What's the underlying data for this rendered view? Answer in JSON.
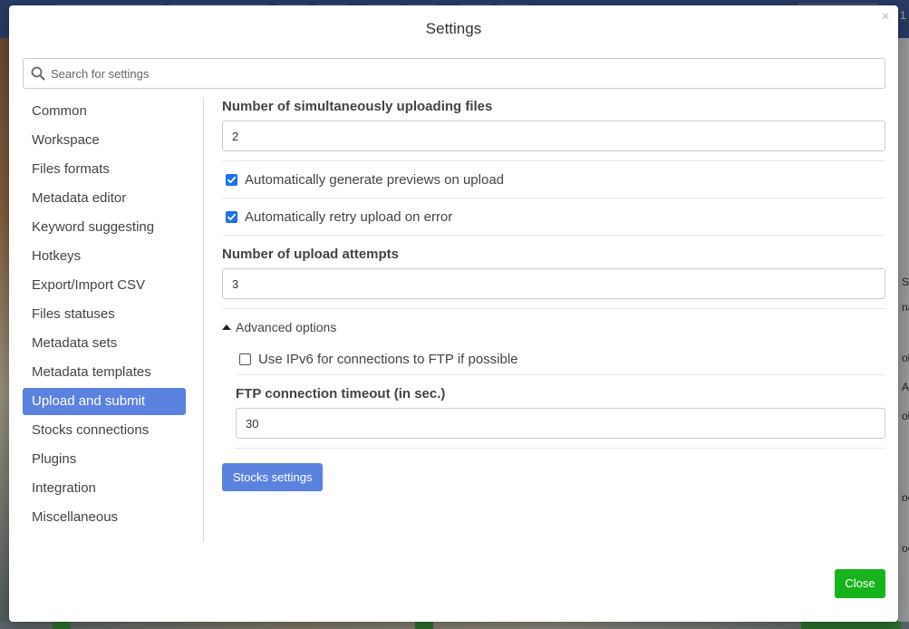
{
  "dialog": {
    "title": "Settings",
    "close_glyph": "×",
    "close_label": "Close"
  },
  "search": {
    "placeholder": "Search for settings",
    "value": ""
  },
  "sidebar": {
    "items": [
      {
        "label": "Common"
      },
      {
        "label": "Workspace"
      },
      {
        "label": "Files formats"
      },
      {
        "label": "Metadata editor"
      },
      {
        "label": "Keyword suggesting"
      },
      {
        "label": "Hotkeys"
      },
      {
        "label": "Export/Import CSV"
      },
      {
        "label": "Files statuses"
      },
      {
        "label": "Metadata sets"
      },
      {
        "label": "Metadata templates"
      },
      {
        "label": "Upload and submit",
        "active": true
      },
      {
        "label": "Stocks connections"
      },
      {
        "label": "Plugins"
      },
      {
        "label": "Integration"
      },
      {
        "label": "Miscellaneous"
      }
    ]
  },
  "content": {
    "simultaneous_label": "Number of simultaneously uploading files",
    "simultaneous_value": "2",
    "gen_previews_label": "Automatically generate previews on upload",
    "gen_previews_checked": true,
    "retry_label": "Automatically retry upload on error",
    "retry_checked": true,
    "attempts_label": "Number of upload attempts",
    "attempts_value": "3",
    "advanced": {
      "toggle_label": "Advanced options",
      "expanded": true,
      "ipv6_label": "Use IPv6 for connections to FTP if possible",
      "ipv6_checked": false,
      "ftp_timeout_label": "FTP connection timeout (in sec.)",
      "ftp_timeout_value": "30"
    },
    "stocks_settings_label": "Stocks settings"
  },
  "background": {
    "right_edge_fragments": [
      "S",
      "na",
      "ob",
      "Ad",
      "ob",
      "oc",
      "oc"
    ],
    "top_right_fragment": "1"
  },
  "colors": {
    "accent": "#5b82de",
    "checkbox": "#1a73e8",
    "close_button": "#18b21d",
    "topbar": "#3f5b9a"
  }
}
